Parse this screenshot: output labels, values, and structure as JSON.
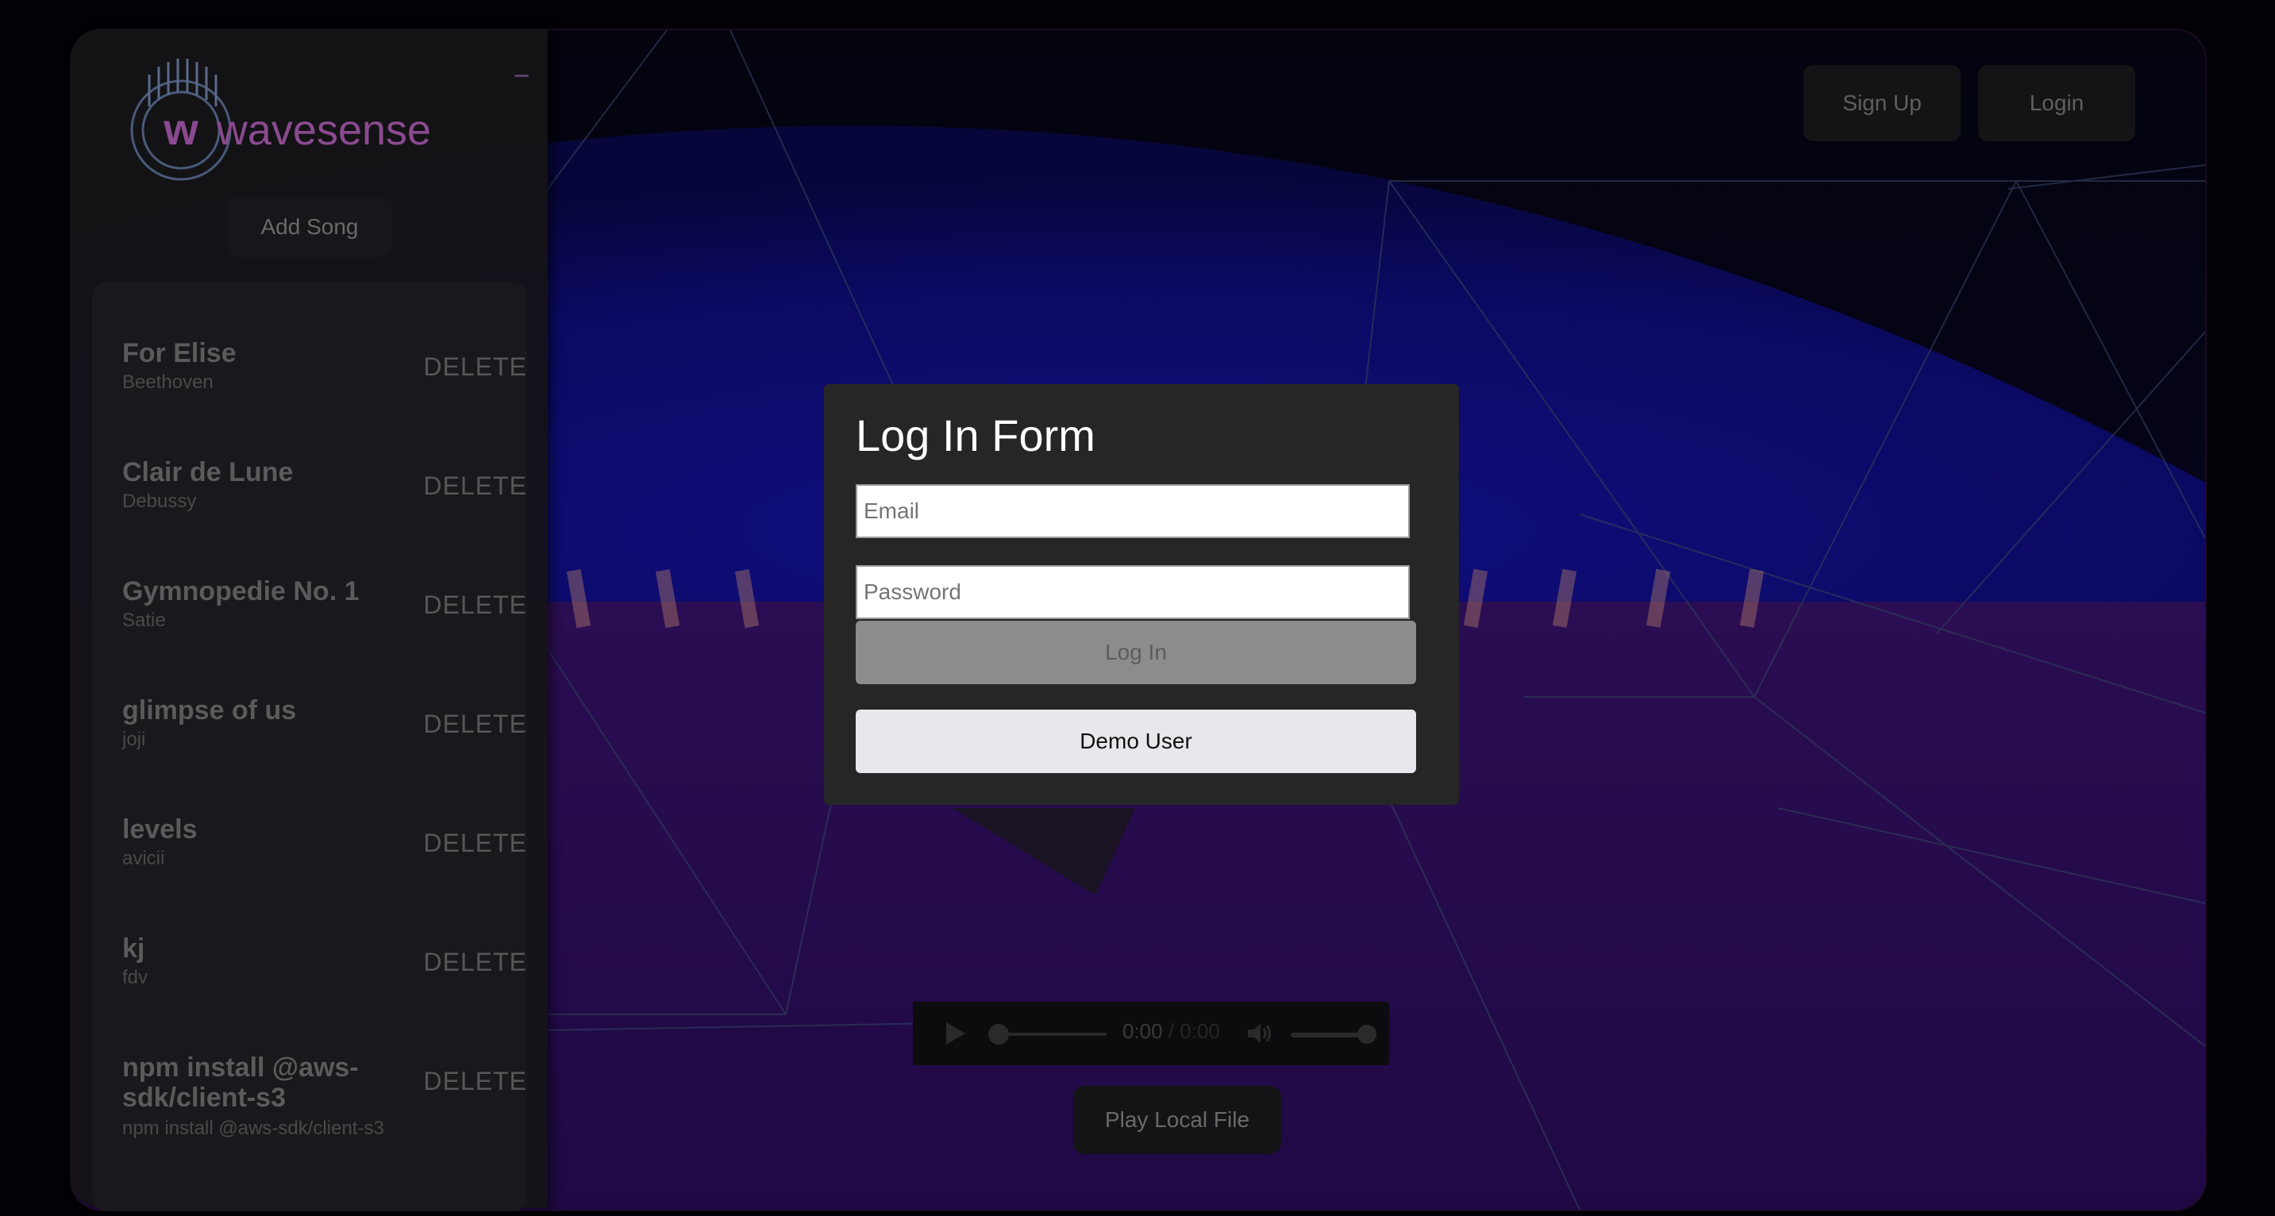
{
  "app": {
    "logo_text": "wavesense"
  },
  "sidebar": {
    "add_song_label": "Add Song",
    "songs": [
      {
        "title": "For Elise",
        "artist": "Beethoven",
        "delete_label": "DELETE"
      },
      {
        "title": "Clair de Lune",
        "artist": "Debussy",
        "delete_label": "DELETE"
      },
      {
        "title": "Gymnopedie No. 1",
        "artist": "Satie",
        "delete_label": "DELETE"
      },
      {
        "title": "glimpse of us",
        "artist": "joji",
        "delete_label": "DELETE"
      },
      {
        "title": "levels",
        "artist": "avicii",
        "delete_label": "DELETE"
      },
      {
        "title": "kj",
        "artist": "fdv",
        "delete_label": "DELETE"
      },
      {
        "title": "npm install @aws-sdk/client-s3",
        "artist": "npm install @aws-sdk/client-s3",
        "delete_label": "DELETE"
      }
    ]
  },
  "header": {
    "signup_label": "Sign Up",
    "login_label": "Login"
  },
  "login_form": {
    "title": "Log In Form",
    "email_placeholder": "Email",
    "password_placeholder": "Password",
    "submit_label": "Log In",
    "demo_label": "Demo User"
  },
  "player": {
    "current_time": "0:00",
    "separator": " / ",
    "duration": "0:00",
    "progress": 0,
    "volume": 1.0
  },
  "play_local_label": "Play Local File",
  "colors": {
    "accent": "#8a4a8f",
    "modal_bg": "#262626",
    "sky": "#0a0850",
    "floor": "#220a45"
  },
  "icons": [
    "play-icon",
    "volume-icon",
    "collapse-icon",
    "logo-icon"
  ]
}
